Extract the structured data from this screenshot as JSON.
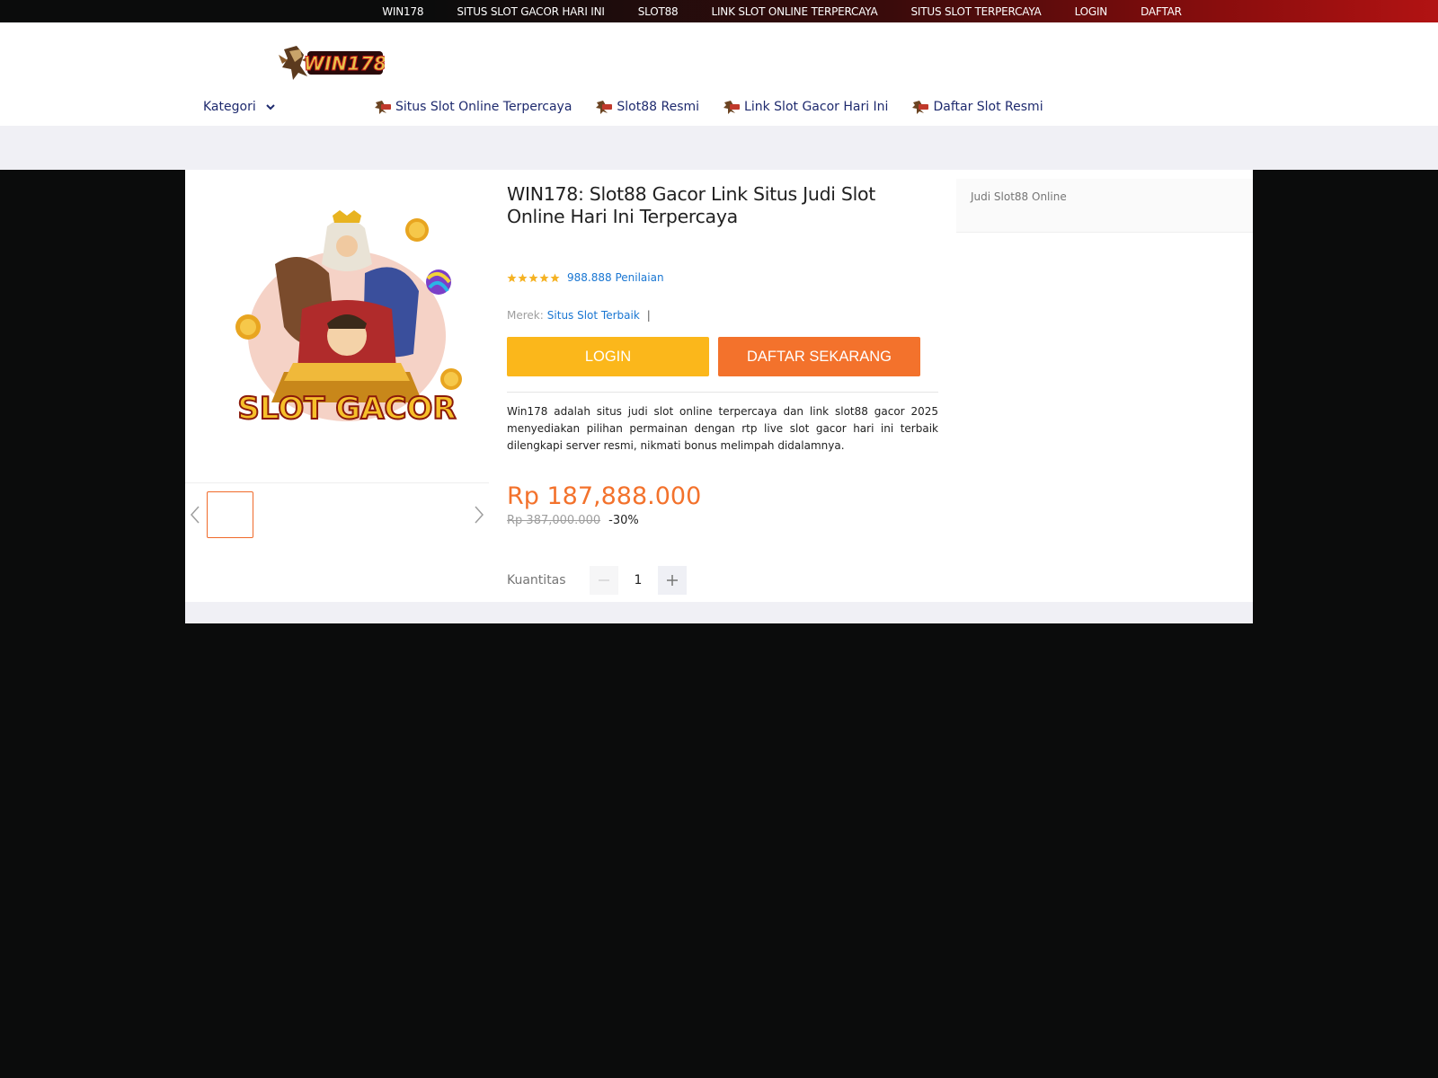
{
  "topbar": {
    "links": [
      "WIN178",
      "SITUS SLOT GACOR HARI INI",
      "SLOT88",
      "LINK SLOT ONLINE TERPERCAYA",
      "SITUS SLOT TERPERCAYA",
      "LOGIN",
      "DAFTAR"
    ]
  },
  "header": {
    "logo_text": "WIN178",
    "kategori_label": "Kategori",
    "nav": [
      {
        "label": "Situs Slot Online Terpercaya",
        "icon": "win178-mini-logo-icon"
      },
      {
        "label": "Slot88 Resmi",
        "icon": "win178-mini-logo-icon"
      },
      {
        "label": "Link Slot Gacor Hari Ini",
        "icon": "win178-mini-logo-icon"
      },
      {
        "label": "Daftar Slot Resmi",
        "icon": "win178-mini-logo-icon"
      }
    ]
  },
  "product": {
    "image_text": "SLOT GACOR",
    "title": "WIN178: Slot88 Gacor Link Situs Judi Slot Online Hari Ini Terpercaya",
    "stars": 5,
    "rating_text": "988.888 Penilaian",
    "brand_label": "Merek:",
    "brand_value": "Situs Slot Terbaik",
    "brand_sep": "|",
    "login_button": "LOGIN",
    "daftar_button": "DAFTAR SEKARANG",
    "description": "Win178 adalah situs judi slot online terpercaya dan link slot88 gacor 2025 menyediakan pilihan permainan dengan rtp live slot gacor hari ini terbaik dilengkapi server resmi, nikmati bonus melimpah didalamnya.",
    "price": "Rp 187,888.000",
    "old_price": "Rp 387,000.000",
    "discount": "-30%",
    "quantity_label": "Kuantitas",
    "quantity_value": "1"
  },
  "sidebar": {
    "label": "Judi Slot88 Online"
  },
  "colors": {
    "login": "#fbb71b",
    "daftar": "#f3722c",
    "price": "#f3722c",
    "link": "#1976d2",
    "nav_text": "#1e2a6e"
  }
}
